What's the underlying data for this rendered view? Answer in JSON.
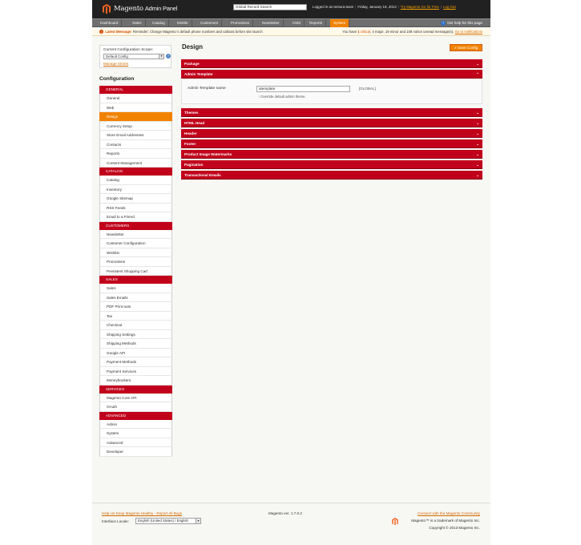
{
  "header": {
    "logo_name": "Magento",
    "logo_sub": "Admin Panel",
    "search_value": "Global Record Search",
    "logged_in": "Logged in as tentura-team",
    "date": "Friday, January 18, 2013",
    "try_link": "Try Magento Go for Free",
    "logout": "Log Out"
  },
  "nav": {
    "items": [
      "Dashboard",
      "Sales",
      "Catalog",
      "Mobile",
      "Customers",
      "Promotions",
      "Newsletter",
      "CMS",
      "Reports",
      "System"
    ],
    "active": "System",
    "help": "Get help for this page"
  },
  "notice": {
    "label": "Latest Message:",
    "message": "Reminder: Change Magento`s default phone numbers and callouts before site launch",
    "right_prefix": "You have",
    "critical_count": "1",
    "critical_label": "critical",
    "major": "4 major,",
    "minor": "19 minor and 108 notice unread message(s).",
    "go_link": "Go to notifications"
  },
  "scope": {
    "label": "Current Configuration Scope:",
    "selected": "Default Config",
    "manage": "Manage Stores"
  },
  "sidebar": {
    "title": "Configuration",
    "groups": [
      {
        "head": "GENERAL",
        "items": [
          "General",
          "Web",
          "Design",
          "Currency Setup",
          "Store Email Addresses",
          "Contacts",
          "Reports",
          "Content Management"
        ]
      },
      {
        "head": "CATALOG",
        "items": [
          "Catalog",
          "Inventory",
          "Google Sitemap",
          "RSS Feeds",
          "Email to a Friend"
        ]
      },
      {
        "head": "CUSTOMERS",
        "items": [
          "Newsletter",
          "Customer Configuration",
          "Wishlist",
          "Promotions",
          "Persistent Shopping Cart"
        ]
      },
      {
        "head": "SALES",
        "items": [
          "Sales",
          "Sales Emails",
          "PDF Print-outs",
          "Tax",
          "Checkout",
          "Shipping Settings",
          "Shipping Methods",
          "Google API",
          "Payment Methods",
          "Payment Services",
          "Moneybookers"
        ]
      },
      {
        "head": "SERVICES",
        "items": [
          "Magento Core API",
          "OAuth"
        ]
      },
      {
        "head": "ADVANCED",
        "items": [
          "Admin",
          "System",
          "Advanced",
          "Developer"
        ]
      }
    ],
    "active": "Design"
  },
  "main": {
    "title": "Design",
    "save": "Save Config",
    "sections": [
      "Package",
      "Admin Template",
      "Themes",
      "HTML Head",
      "Header",
      "Footer",
      "Product Image Watermarks",
      "Pagination",
      "Transactional Emails"
    ],
    "field": {
      "label": "Admin Template name",
      "value": "atemplate",
      "scope": "[GLOBAL]",
      "note": "Override default admin theme."
    }
  },
  "footer": {
    "help": "Help Us Keep Magento Healthy - Report All Bugs",
    "locale_label": "Interface Locale:",
    "locale_value": "English (United States) / English",
    "version": "Magento ver. 1.7.0.2",
    "community": "Connect with the Magento Community",
    "trademark": "Magento™ is a trademark of Magento Inc.",
    "copyright": "Copyright © 2013 Magento Inc."
  },
  "colors": {
    "accent_orange": "#f18200",
    "section_red": "#c1001b",
    "header_dark": "#212121"
  }
}
